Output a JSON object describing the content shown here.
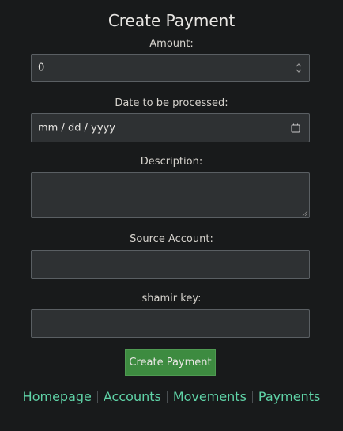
{
  "form": {
    "title": "Create Payment",
    "amount": {
      "label": "Amount:",
      "value": "0",
      "spinner_icon": "spin-up-down-icon"
    },
    "date": {
      "label": "Date to be processed:",
      "placeholder": "mm / dd / yyyy",
      "calendar_icon": "calendar-icon"
    },
    "description": {
      "label": "Description:",
      "value": "",
      "resize_icon": "resize-handle-icon"
    },
    "source_account": {
      "label": "Source Account:",
      "value": ""
    },
    "shamir_key": {
      "label": "shamir key:",
      "value": ""
    },
    "submit_label": "Create Payment"
  },
  "nav": {
    "items": [
      {
        "label": "Homepage"
      },
      {
        "label": "Accounts"
      },
      {
        "label": "Movements"
      },
      {
        "label": "Payments"
      }
    ]
  },
  "colors": {
    "background": "#181a1b",
    "input_background": "#2e3133",
    "button": "#3d8b40",
    "link": "#5fd3a7"
  }
}
